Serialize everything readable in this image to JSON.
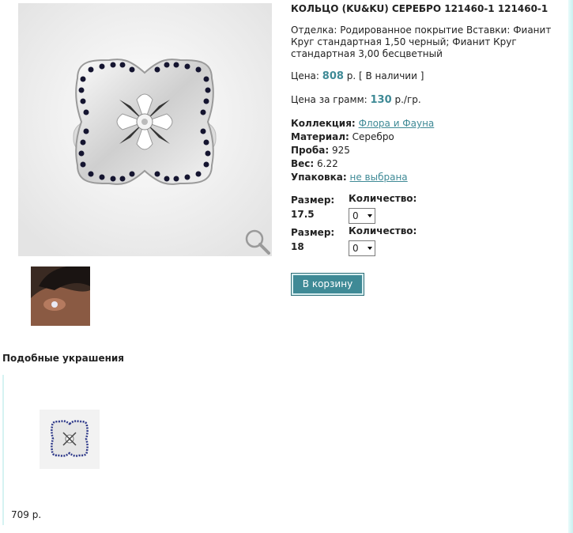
{
  "product": {
    "title": "КОЛЬЦО (KU&KU) СЕРЕБРО 121460-1 121460-1",
    "finish": "Отделка: Родированное покрытие Вставки: Фианит Круг стандартная 1,50 черный; Фианит Круг стандартная 3,00 бесцветный",
    "price_label": "Цена:",
    "price_value": "808",
    "price_suffix": "р. [ В наличии ]",
    "gram_label": "Цена за грамм:",
    "gram_value": "130",
    "gram_suffix": "р./гр."
  },
  "specs": {
    "collection_label": "Коллекция:",
    "collection_value": "Флора и Фауна",
    "material_label": "Материал:",
    "material_value": "Серебро",
    "probe_label": "Проба:",
    "probe_value": "925",
    "weight_label": "Вес:",
    "weight_value": "6.22",
    "package_label": "Упаковка:",
    "package_value": "не выбрана"
  },
  "sizes": [
    {
      "size_label": "Размер:",
      "size_value": "17.5",
      "qty_label": "Количество:",
      "qty_value": "0"
    },
    {
      "size_label": "Размер:",
      "size_value": "18",
      "qty_label": "Количество:",
      "qty_value": "0"
    }
  ],
  "cart_button": "В корзину",
  "similar": {
    "title": "Подобные украшения",
    "items": [
      {
        "price": "709 р."
      }
    ]
  },
  "icons": {
    "zoom": "magnifier-icon"
  },
  "colors": {
    "accent": "#3f8a96",
    "edge": "#c9f1f0"
  }
}
